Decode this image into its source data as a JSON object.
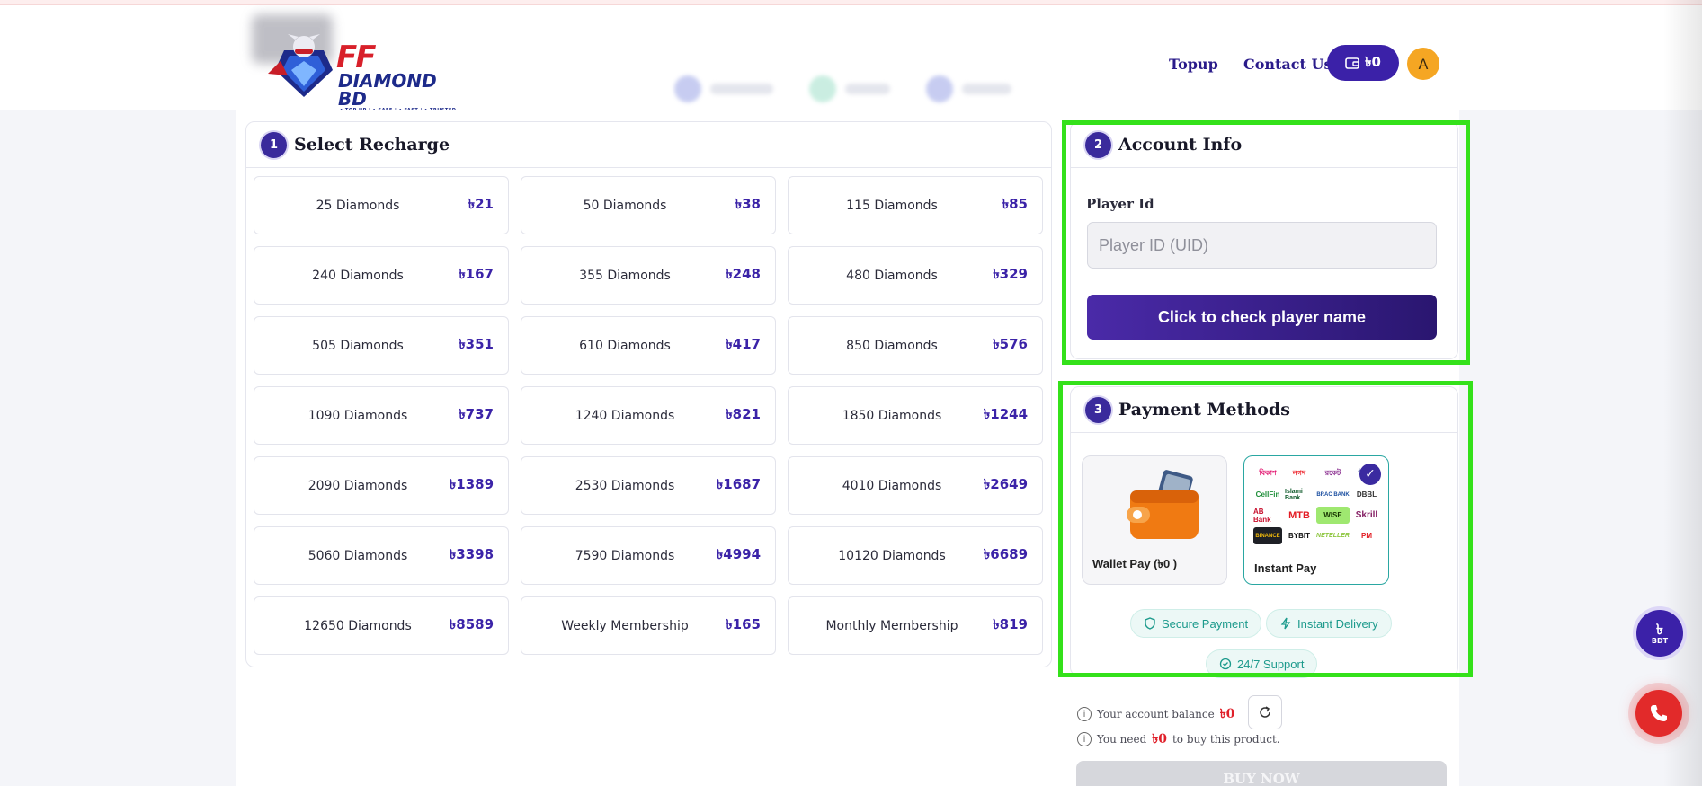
{
  "header": {
    "logo": {
      "ff": "FF",
      "name": "DIAMOND BD",
      "tagline": "• TOP UP | • SAFE | • FAST | • TRUSTED"
    },
    "nav": {
      "topup": "Topup",
      "contact": "Contact Us"
    },
    "wallet_amount": "৳0",
    "avatar_initial": "A"
  },
  "recharge": {
    "step": "1",
    "title": "Select Recharge",
    "items": [
      {
        "name": "25 Diamonds",
        "price": "৳21"
      },
      {
        "name": "50 Diamonds",
        "price": "৳38"
      },
      {
        "name": "115 Diamonds",
        "price": "৳85"
      },
      {
        "name": "240 Diamonds",
        "price": "৳167"
      },
      {
        "name": "355 Diamonds",
        "price": "৳248"
      },
      {
        "name": "480 Diamonds",
        "price": "৳329"
      },
      {
        "name": "505 Diamonds",
        "price": "৳351"
      },
      {
        "name": "610 Diamonds",
        "price": "৳417"
      },
      {
        "name": "850 Diamonds",
        "price": "৳576"
      },
      {
        "name": "1090 Diamonds",
        "price": "৳737"
      },
      {
        "name": "1240 Diamonds",
        "price": "৳821"
      },
      {
        "name": "1850 Diamonds",
        "price": "৳1244"
      },
      {
        "name": "2090 Diamonds",
        "price": "৳1389"
      },
      {
        "name": "2530 Diamonds",
        "price": "৳1687"
      },
      {
        "name": "4010 Diamonds",
        "price": "৳2649"
      },
      {
        "name": "5060 Diamonds",
        "price": "৳3398"
      },
      {
        "name": "7590 Diamonds",
        "price": "৳4994"
      },
      {
        "name": "10120 Diamonds",
        "price": "৳6689"
      },
      {
        "name": "12650 Diamonds",
        "price": "৳8589"
      },
      {
        "name": "Weekly Membership",
        "price": "৳165"
      },
      {
        "name": "Monthly Membership",
        "price": "৳819"
      }
    ]
  },
  "account": {
    "step": "2",
    "title": "Account Info",
    "label": "Player Id",
    "placeholder": "Player ID (UID)",
    "value": "",
    "check_button": "Click to check player name"
  },
  "payment": {
    "step": "3",
    "title": "Payment Methods",
    "methods": [
      {
        "label": "Wallet Pay (৳0 )",
        "icon": "wallet-icon",
        "selected": false
      },
      {
        "label": "Instant Pay",
        "icon": "bank-logos",
        "selected": true
      }
    ],
    "instant_logos": [
      "বিকাশ",
      "নগদ",
      "রকেট",
      "উপায়",
      "CellFin",
      "Islami Bank",
      "BRAC BANK",
      "DBBL",
      "AB Bank",
      "MTB",
      "WISE",
      "Skrill",
      "BINANCE",
      "BYBIT",
      "NETELLER",
      "PM"
    ],
    "badges": [
      "Secure Payment",
      "Instant Delivery",
      "24/7 Support"
    ]
  },
  "balance": {
    "balance_text": "Your account balance",
    "balance_amount": "৳0",
    "need_prefix": "You need",
    "need_amount": "৳0",
    "need_suffix": "to buy this product."
  },
  "buy_button": "BUY NOW",
  "floating": {
    "currency_symbol": "৳",
    "currency_code": "BDT"
  },
  "colors": {
    "primary": "#3b21a8",
    "price": "#3b23a8",
    "highlight": "#34e11a",
    "teal": "#1c9a8c",
    "danger": "#e0202a"
  }
}
